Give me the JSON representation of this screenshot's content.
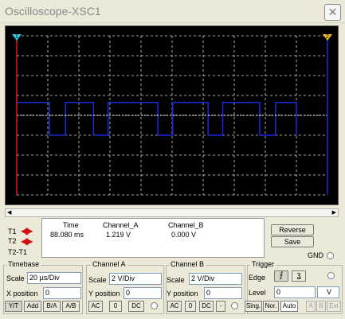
{
  "window": {
    "title": "Oscilloscope-XSC1",
    "close_icon": "close-icon"
  },
  "scope": {
    "grid_divisions": 10,
    "cursor1_marker": "1",
    "cursor2_marker": "2",
    "trace_color": "#1a2bd8",
    "cursor1_color": "#e02020",
    "cursor2_color": "#1a2bd8",
    "grid_color": "#d8d8d8"
  },
  "cursors": {
    "t1": "T1",
    "t2": "T2",
    "t2t1": "T2-T1",
    "arrow_icon": "left-right-arrows-icon"
  },
  "readout": {
    "headers": {
      "time": "Time",
      "channel_a": "Channel_A",
      "channel_b": "Channel_B"
    },
    "t1": {
      "time": "88.080 ms",
      "channel_a": "1.219 V",
      "channel_b": "0.000 V"
    }
  },
  "buttons": {
    "reverse": "Reverse",
    "save": "Save",
    "gnd": "GND"
  },
  "timebase": {
    "title": "Timebase",
    "scale_label": "Scale",
    "scale_value": "20 µs/Div",
    "xpos_label": "X position",
    "xpos_value": "0",
    "modes": [
      "Y/T",
      "Add",
      "B/A",
      "A/B"
    ]
  },
  "channel_a": {
    "title": "Channel A",
    "scale_label": "Scale",
    "scale_value": "2  V/Div",
    "ypos_label": "Y position",
    "ypos_value": "0",
    "coupling": [
      "AC",
      "0",
      "DC"
    ]
  },
  "channel_b": {
    "title": "Channel B",
    "scale_label": "Scale",
    "scale_value": "2  V/Div",
    "ypos_label": "Y position",
    "ypos_value": "0",
    "coupling": [
      "AC",
      "0",
      "DC",
      "-"
    ]
  },
  "trigger": {
    "title": "Trigger",
    "edge_label": "Edge",
    "level_label": "Level",
    "level_value": "0",
    "level_unit": "V",
    "modes": [
      "Sing.",
      "Nor.",
      "Auto"
    ],
    "sources": [
      "A",
      "B",
      "Ext"
    ]
  }
}
